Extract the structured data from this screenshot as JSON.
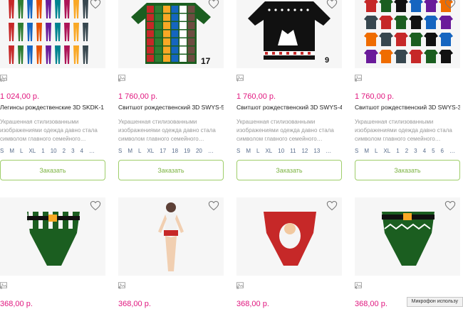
{
  "cards_row1": [
    {
      "photos": "10",
      "price": "1 024,00 р.",
      "title": "Легинсы рождественские 3D SKDK-1",
      "desc": "Украшенная стилизованными изображениями одежда давно стала символом главного семейного…",
      "sizes": [
        "S",
        "M",
        "L",
        "XL",
        "1",
        "10",
        "2",
        "3",
        "4",
        "…"
      ],
      "button": "Заказать",
      "image_kind": "leggings-grid"
    },
    {
      "photos": "8",
      "price": "1 760,00 р.",
      "title": "Свитшот рождественский 3D SWYS-5",
      "desc": "Украшенная стилизованными изображениями одежда давно стала символом главного семейного…",
      "sizes": [
        "S",
        "M",
        "L",
        "XL",
        "17",
        "18",
        "19",
        "20",
        "…"
      ],
      "button": "Заказать",
      "image_kind": "sweater-patchwork",
      "image_number": "17"
    },
    {
      "photos": "7",
      "price": "1 760,00 р.",
      "title": "Свитшот рождественский 3D SWYS-4",
      "desc": "Украшенная стилизованными изображениями одежда давно стала символом главного семейного…",
      "sizes": [
        "S",
        "M",
        "L",
        "XL",
        "10",
        "11",
        "12",
        "13",
        "…"
      ],
      "button": "Заказать",
      "image_kind": "sweater-black",
      "image_number": "9"
    },
    {
      "photos": "8",
      "price": "1 760,00 р.",
      "title": "Свитшот рождественский 3D SWYS-3",
      "desc": "Украшенная стилизованными изображениями одежда давно стала символом главного семейного…",
      "sizes": [
        "S",
        "M",
        "L",
        "XL",
        "1",
        "2",
        "3",
        "4",
        "5",
        "6",
        "…"
      ],
      "button": "Заказать",
      "image_kind": "sweater-grid"
    }
  ],
  "cards_row2": [
    {
      "photos": "6",
      "price": "368,00 р.",
      "image_kind": "panties-green"
    },
    {
      "photos": "4",
      "price": "368,00 р.",
      "image_kind": "model"
    },
    {
      "photos": "5",
      "price": "368,00 р.",
      "image_kind": "panties-santa"
    },
    {
      "photos": "4",
      "price": "368,00 р.",
      "image_kind": "panties-zigzag"
    }
  ],
  "toast": "Микрофон использу",
  "colors": {
    "price": "#e0167e",
    "button_border": "#9fce6a",
    "button_text": "#7cb342"
  },
  "icons": {
    "favorite": "heart-outline-icon",
    "photos": "photo-icon"
  }
}
